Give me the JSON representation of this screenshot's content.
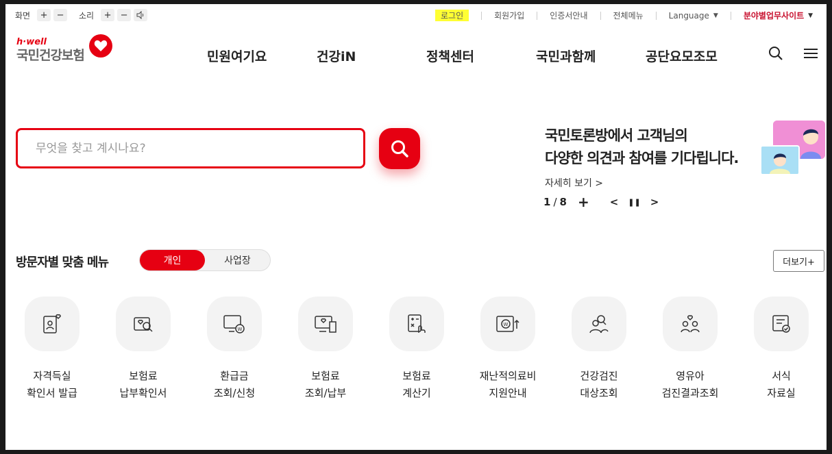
{
  "util": {
    "screen_label": "화면",
    "sound_label": "소리",
    "plus": "+",
    "minus": "−",
    "links": {
      "login": "로그인",
      "signup": "회원가입",
      "cert": "인증서안내",
      "allmenu": "전체메뉴",
      "language": "Language",
      "field_site": "분야별업무사이트"
    }
  },
  "logo": {
    "tagline": "h·well",
    "name": "국민건강보험"
  },
  "gnb": [
    "민원여기요",
    "건강iN",
    "정책센터",
    "국민과함께",
    "공단요모조모"
  ],
  "search": {
    "placeholder": "무엇을 찾고 계시나요?"
  },
  "promo": {
    "line1": "국민토론방에서 고객님의",
    "line2": "다양한 의견과 참여를 기다립니다.",
    "more": "자세히 보기 >",
    "page_current": "1",
    "page_sep": "/",
    "page_total": "8",
    "plus": "+",
    "prev": "<",
    "pause": "❚❚",
    "next": ">"
  },
  "visitor": {
    "title": "방문자별 맞춤 메뉴",
    "tab_personal": "개인",
    "tab_business": "사업장",
    "more": "더보기+"
  },
  "services": [
    {
      "l1": "자격득실",
      "l2": "확인서 발급"
    },
    {
      "l1": "보험료",
      "l2": "납부확인서"
    },
    {
      "l1": "환급금",
      "l2": "조회/신청"
    },
    {
      "l1": "보험료",
      "l2": "조회/납부"
    },
    {
      "l1": "보험료",
      "l2": "계산기"
    },
    {
      "l1": "재난적의료비",
      "l2": "지원안내"
    },
    {
      "l1": "건강검진",
      "l2": "대상조회"
    },
    {
      "l1": "영유아",
      "l2": "검진결과조회"
    },
    {
      "l1": "서식",
      "l2": "자료실"
    }
  ],
  "colors": {
    "brand": "#e60012",
    "highlight": "#ffff33"
  }
}
